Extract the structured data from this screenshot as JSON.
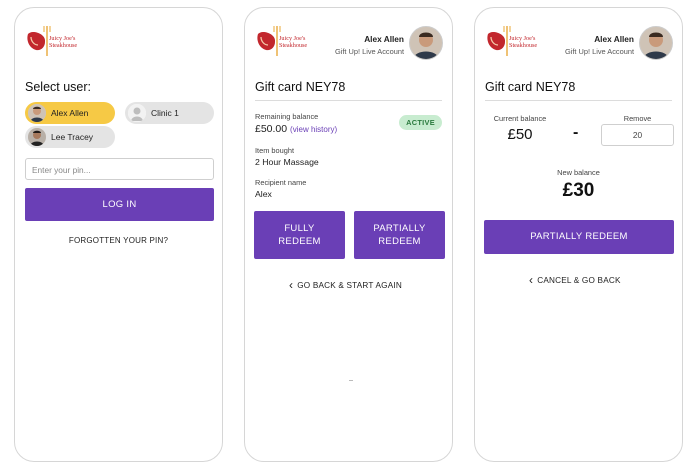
{
  "brand": {
    "logo_line1": "Juicy Joe's",
    "logo_line2": "Steakhouse",
    "accent": "#6a3fb6"
  },
  "login": {
    "title": "Select user:",
    "users": [
      {
        "name": "Alex Allen",
        "selected": true,
        "icon": "user-photo-icon"
      },
      {
        "name": "Clinic 1",
        "selected": false,
        "icon": "default-avatar-icon"
      },
      {
        "name": "Lee Tracey",
        "selected": false,
        "icon": "user-photo-icon"
      }
    ],
    "pin_placeholder": "Enter your pin...",
    "login_button": "LOG IN",
    "forgot_link": "FORGOTTEN YOUR PIN?"
  },
  "header": {
    "user_name": "Alex Allen",
    "account": "Gift Up! Live Account"
  },
  "gift_card": {
    "title": "Gift card NEY78",
    "remaining_label": "Remaining balance",
    "remaining_value": "£50.00",
    "view_history": "(view history)",
    "status": "ACTIVE",
    "item_label": "Item bought",
    "item_value": "2 Hour Massage",
    "recipient_label": "Recipient name",
    "recipient_value": "Alex",
    "fully_redeem_1": "FULLY",
    "fully_redeem_2": "REDEEM",
    "partially_redeem_1": "PARTIALLY",
    "partially_redeem_2": "REDEEM",
    "back_link": "GO BACK & START AGAIN"
  },
  "redeem": {
    "title": "Gift card NEY78",
    "current_label": "Current balance",
    "current_value": "£50",
    "operator": "-",
    "remove_label": "Remove",
    "remove_value": "20",
    "new_label": "New balance",
    "new_value": "£30",
    "button": "PARTIALLY REDEEM",
    "cancel_link": "CANCEL & GO BACK"
  }
}
